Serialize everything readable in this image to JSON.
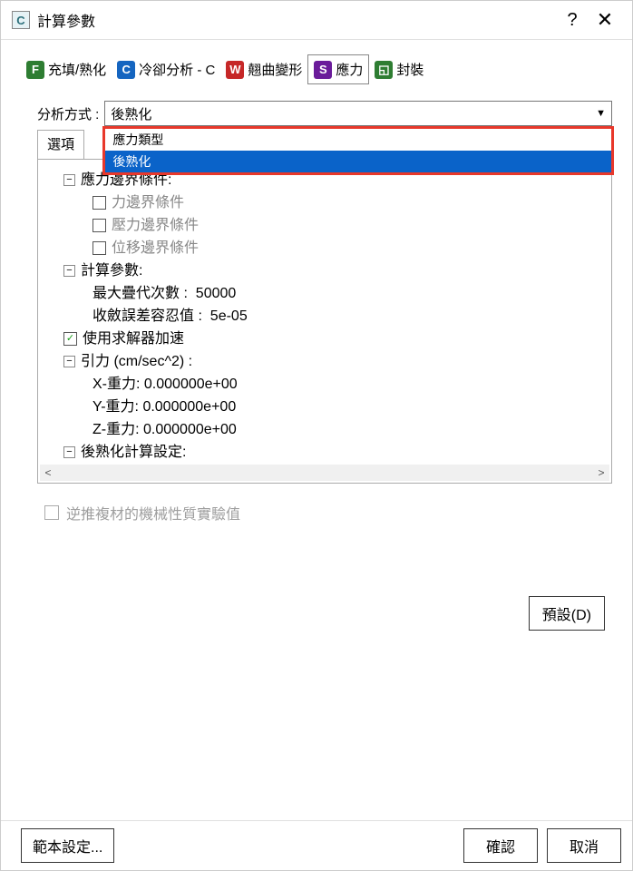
{
  "title": "計算參數",
  "titlebar": {
    "help": "?",
    "close": "✕"
  },
  "tabs": [
    {
      "icon": "F",
      "label": "充填/熟化",
      "iconClass": "f"
    },
    {
      "icon": "C",
      "label": "冷卻分析 - C",
      "iconClass": "c"
    },
    {
      "icon": "W",
      "label": "翹曲變形",
      "iconClass": "w"
    },
    {
      "icon": "S",
      "label": "應力",
      "iconClass": "s"
    },
    {
      "icon": "",
      "label": "封裝",
      "iconClass": "p"
    }
  ],
  "analysis": {
    "label": "分析方式 :",
    "value": "後熟化",
    "options": [
      "應力類型",
      "後熟化"
    ]
  },
  "options_header": "選項",
  "tree": {
    "boundary": {
      "label": "應力邊界條件:",
      "items": [
        "力邊界條件",
        "壓力邊界條件",
        "位移邊界條件"
      ]
    },
    "calc": {
      "label": "計算參數:",
      "max_iter_label": "最大疊代次數 :",
      "max_iter_val": "50000",
      "tol_label": "收斂誤差容忍值 :",
      "tol_val": "5e-05"
    },
    "solver_accel": "使用求解器加速",
    "gravity": {
      "label": "引力 (cm/sec^2) :",
      "x_label": "X-重力:",
      "x_val": "0.000000e+00",
      "y_label": "Y-重力:",
      "y_val": "0.000000e+00",
      "z_label": "Z-重力:",
      "z_val": "0.000000e+00"
    },
    "postcure": "後熟化計算設定:"
  },
  "toggle": {
    "minus": "−"
  },
  "experiment_checkbox": "逆推複材的機械性質實驗值",
  "buttons": {
    "default": "預設(D)",
    "template": "範本設定...",
    "ok": "確認",
    "cancel": "取消"
  }
}
